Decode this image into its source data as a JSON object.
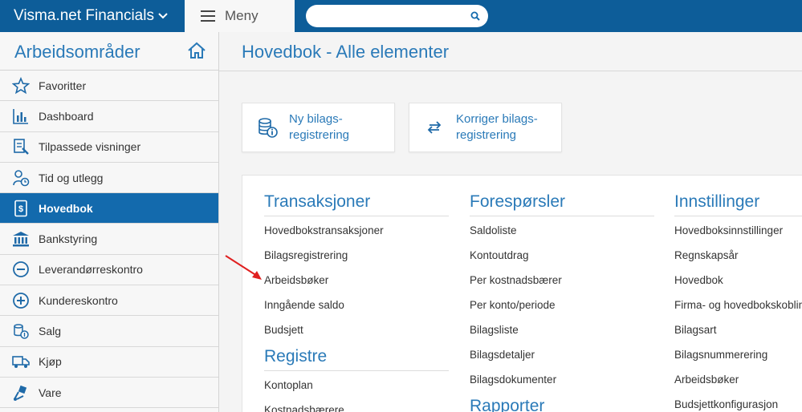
{
  "topbar": {
    "brand": "Visma.net Financials",
    "menu_label": "Meny",
    "search_placeholder": "",
    "search_value": ""
  },
  "sidebar": {
    "title": "Arbeidsområder",
    "items": [
      {
        "label": "Favoritter",
        "icon": "star-icon",
        "active": false
      },
      {
        "label": "Dashboard",
        "icon": "bar-chart-icon",
        "active": false
      },
      {
        "label": "Tilpassede visninger",
        "icon": "custom-view-icon",
        "active": false
      },
      {
        "label": "Tid og utlegg",
        "icon": "time-expense-icon",
        "active": false
      },
      {
        "label": "Hovedbok",
        "icon": "ledger-icon",
        "active": true
      },
      {
        "label": "Bankstyring",
        "icon": "bank-icon",
        "active": false
      },
      {
        "label": "Leverandørreskontro",
        "icon": "minus-circle-icon",
        "active": false
      },
      {
        "label": "Kundereskontro",
        "icon": "plus-circle-icon",
        "active": false
      },
      {
        "label": "Salg",
        "icon": "sales-icon",
        "active": false
      },
      {
        "label": "Kjøp",
        "icon": "truck-icon",
        "active": false
      },
      {
        "label": "Vare",
        "icon": "hand-truck-icon",
        "active": false
      }
    ]
  },
  "main": {
    "title": "Hovedbok - Alle elementer",
    "tiles": [
      {
        "label": "Ny bilags-registrering",
        "icon": "coins-info-icon"
      },
      {
        "label": "Korriger bilags-registrering",
        "icon": "swap-arrows-icon"
      }
    ],
    "columns": [
      {
        "sections": [
          {
            "title": "Transaksjoner",
            "links": [
              "Hovedbokstransaksjoner",
              "Bilagsregistrering",
              "Arbeidsbøker",
              "Inngående saldo",
              "Budsjett"
            ]
          },
          {
            "title": "Registre",
            "links": [
              "Kontoplan",
              "Kostnadsbærere"
            ]
          }
        ]
      },
      {
        "sections": [
          {
            "title": "Forespørsler",
            "links": [
              "Saldoliste",
              "Kontoutdrag",
              "Per kostnadsbærer",
              "Per konto/periode",
              "Bilagsliste",
              "Bilagsdetaljer",
              "Bilagsdokumenter"
            ]
          },
          {
            "title": "Rapporter",
            "links": []
          }
        ]
      },
      {
        "sections": [
          {
            "title": "Innstillinger",
            "links": [
              "Hovedboksinnstillinger",
              "Regnskapsår",
              "Hovedbok",
              "Firma- og hovedbokskoblinger",
              "Bilagsart",
              "Bilagsnummerering",
              "Arbeidsbøker",
              "Budsjettkonfigurasjon"
            ]
          }
        ]
      }
    ]
  },
  "colors": {
    "topbar": "#0d5d99",
    "accent": "#2a7ab8",
    "active_nav": "#136aad",
    "annotation_arrow": "#e02020"
  }
}
